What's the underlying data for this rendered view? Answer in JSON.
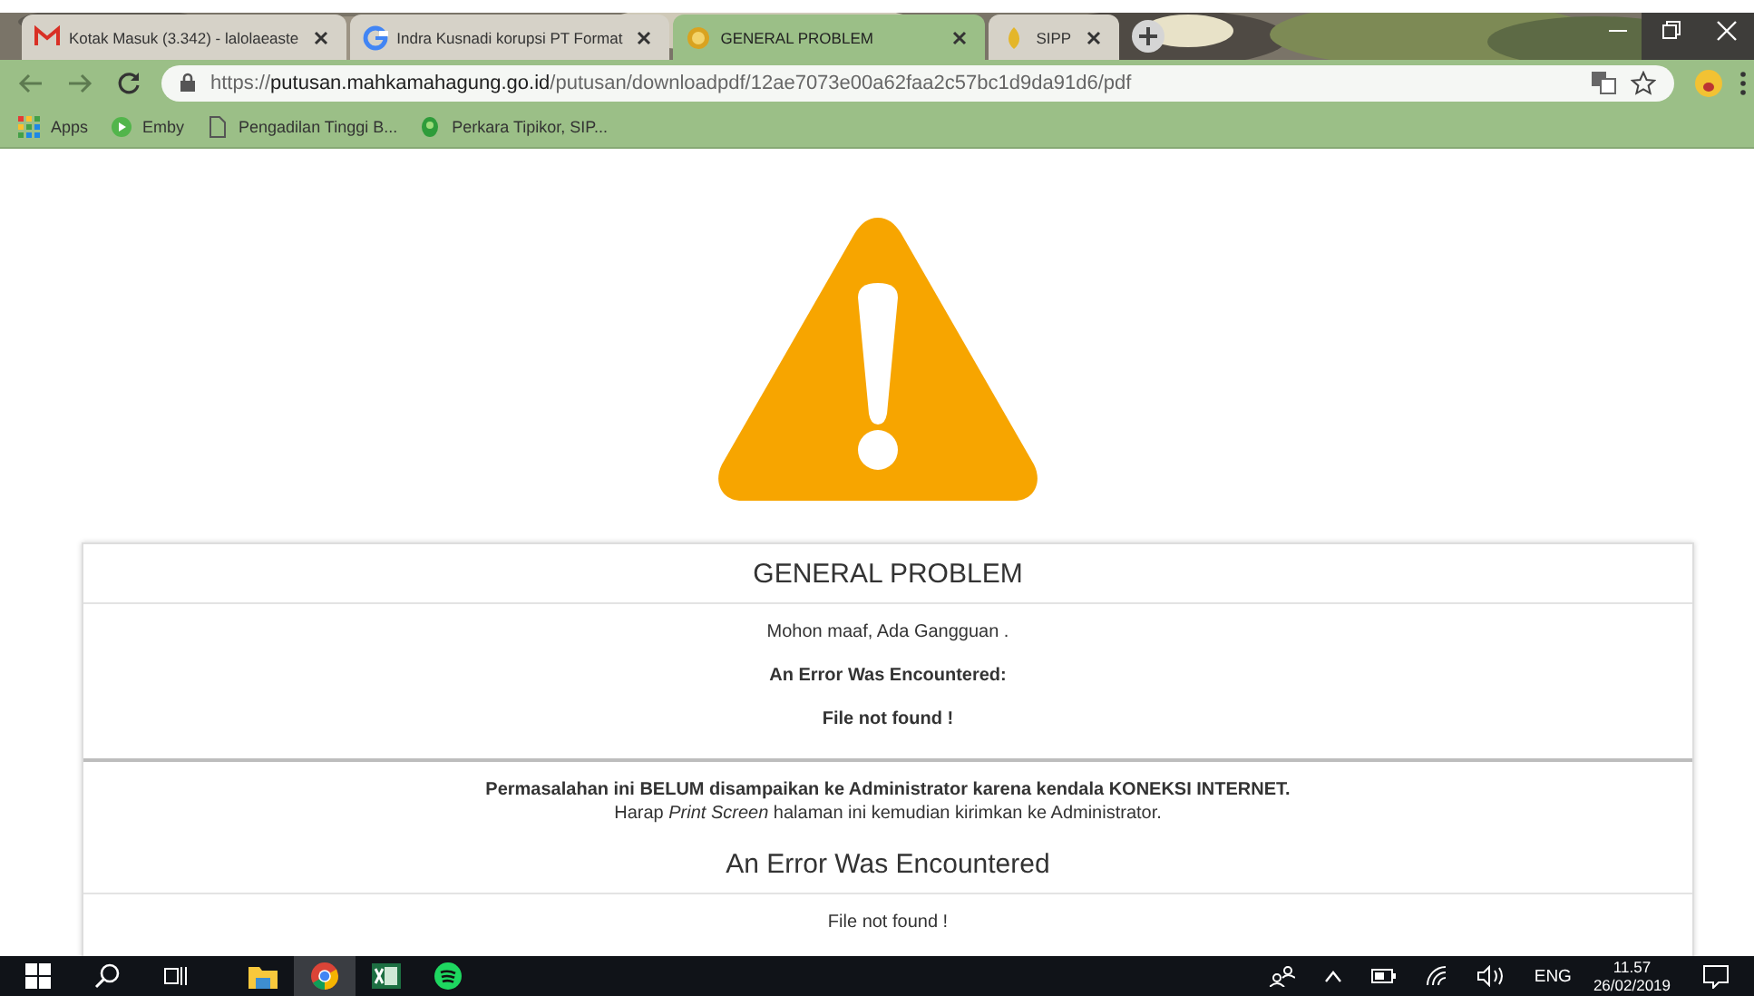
{
  "tabs": [
    {
      "title": "Kotak Masuk (3.342) - lalolaeaste",
      "selected": false
    },
    {
      "title": "Indra Kusnadi korupsi PT Format",
      "selected": false
    },
    {
      "title": "GENERAL PROBLEM",
      "selected": true
    },
    {
      "title": "SIPP",
      "selected": false
    }
  ],
  "address_bar": {
    "scheme": "https://",
    "host": "putusan.mahkamahagung.go.id",
    "path": "/putusan/downloadpdf/12ae7073e00a62faa2c57bc1d9da91d6/pdf"
  },
  "bookmarks": [
    {
      "label": "Apps"
    },
    {
      "label": "Emby"
    },
    {
      "label": "Pengadilan Tinggi B..."
    },
    {
      "label": "Perkara Tipikor, SIP..."
    }
  ],
  "page": {
    "title": "GENERAL PROBLEM",
    "messages": [
      {
        "text": "Mohon maaf, Ada Gangguan .",
        "kind": "normal"
      },
      {
        "text": "An Error Was Encountered:",
        "kind": "bold"
      },
      {
        "text": "File not found !",
        "kind": "bold"
      }
    ],
    "notice": [
      {
        "text": "Permasalahan ini BELUM disampaikan ke Administrator karena kendala KONEKSI INTERNET.",
        "kind": "bold"
      },
      {
        "text": "Harap *Print Screen* halaman ini kemudian kirimkan ke Administrator.",
        "kind": "normal"
      }
    ],
    "section_title": "An Error Was Encountered",
    "section_messages": [
      {
        "text": "File not found !",
        "kind": "normal"
      }
    ]
  },
  "taskbar": {
    "apps": [
      {
        "selected": false
      },
      {
        "selected": true
      },
      {
        "selected": false
      },
      {
        "selected": false
      }
    ],
    "language": "ENG",
    "time": "11.57",
    "date": "26/02/2019"
  }
}
